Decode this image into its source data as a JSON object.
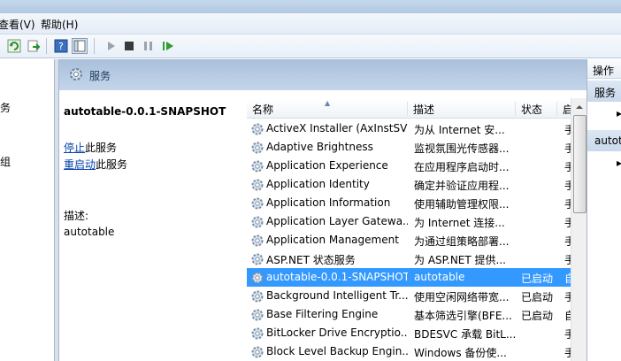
{
  "menubar": {
    "view": "查看(V)",
    "help": "帮助(H)"
  },
  "left_tree": {
    "item1": "务",
    "item2": "组"
  },
  "header": {
    "title": "服务"
  },
  "detail": {
    "service_name": "autotable-0.0.1-SNAPSHOT",
    "stop_link": "停止",
    "stop_suffix": "此服务",
    "restart_link": "重启动",
    "restart_suffix": "此服务",
    "description_label": "描述:",
    "description_value": "autotable"
  },
  "columns": {
    "name": "名称",
    "description": "描述",
    "status": "状态",
    "startup": "启"
  },
  "services": [
    {
      "name": "ActiveX Installer (AxInstSV)",
      "description": "为从 Internet 安...",
      "status": "",
      "startup": "手"
    },
    {
      "name": "Adaptive Brightness",
      "description": "监视氛围光传感器...",
      "status": "",
      "startup": "手"
    },
    {
      "name": "Application Experience",
      "description": "在应用程序启动时...",
      "status": "",
      "startup": "手"
    },
    {
      "name": "Application Identity",
      "description": "确定并验证应用程...",
      "status": "",
      "startup": "手"
    },
    {
      "name": "Application Information",
      "description": "使用辅助管理权限...",
      "status": "",
      "startup": "手"
    },
    {
      "name": "Application Layer Gatewa...",
      "description": "为 Internet 连接...",
      "status": "",
      "startup": "手"
    },
    {
      "name": "Application Management",
      "description": "为通过组策略部署...",
      "status": "",
      "startup": "手"
    },
    {
      "name": "ASP.NET 状态服务",
      "description": "为 ASP.NET 提供...",
      "status": "",
      "startup": "手"
    },
    {
      "name": "autotable-0.0.1-SNAPSHOT",
      "description": "autotable",
      "status": "已启动",
      "startup": "自"
    },
    {
      "name": "Background Intelligent Tr...",
      "description": "使用空闲网络带宽...",
      "status": "已启动",
      "startup": "手"
    },
    {
      "name": "Base Filtering Engine",
      "description": "基本筛选引擎(BFE...",
      "status": "已启动",
      "startup": "自"
    },
    {
      "name": "BitLocker Drive Encryptio...",
      "description": "BDESVC 承载 BitL...",
      "status": "",
      "startup": "手"
    },
    {
      "name": "Block Level Backup Engin...",
      "description": "Windows 备份使...",
      "status": "",
      "startup": "手"
    }
  ],
  "actions": {
    "header": "操作",
    "section1": "服务",
    "section2": "autot"
  },
  "colors": {
    "selected": "#3399ff",
    "link": "#0645ad",
    "header": "#a9c0db"
  }
}
